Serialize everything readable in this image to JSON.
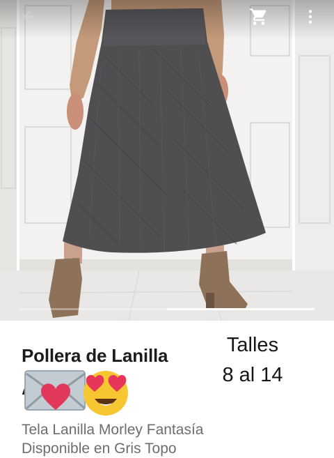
{
  "toolbar": {
    "back_icon": "arrow-left-icon",
    "cart_icon": "shopping-cart-icon",
    "menu_icon": "more-vertical-icon"
  },
  "gallery": {
    "image": "woman-wearing-grey-long-skirt",
    "active_index": 2,
    "page_count": 2
  },
  "product": {
    "title": "Pollera de Lanilla",
    "title_continuation": "A",
    "emoji_names": [
      "love-letter-emoji",
      "heart-eyes-emoji"
    ],
    "sizes_label": "Talles",
    "sizes_range": "8 al 14",
    "description_line1": "Tela Lanilla Morley Fantasía",
    "description_line2": "Disponible en Gris Topo"
  },
  "colors": {
    "skirt": "#4f4f52",
    "background": "#ffffff",
    "description": "#6d6d6d"
  }
}
